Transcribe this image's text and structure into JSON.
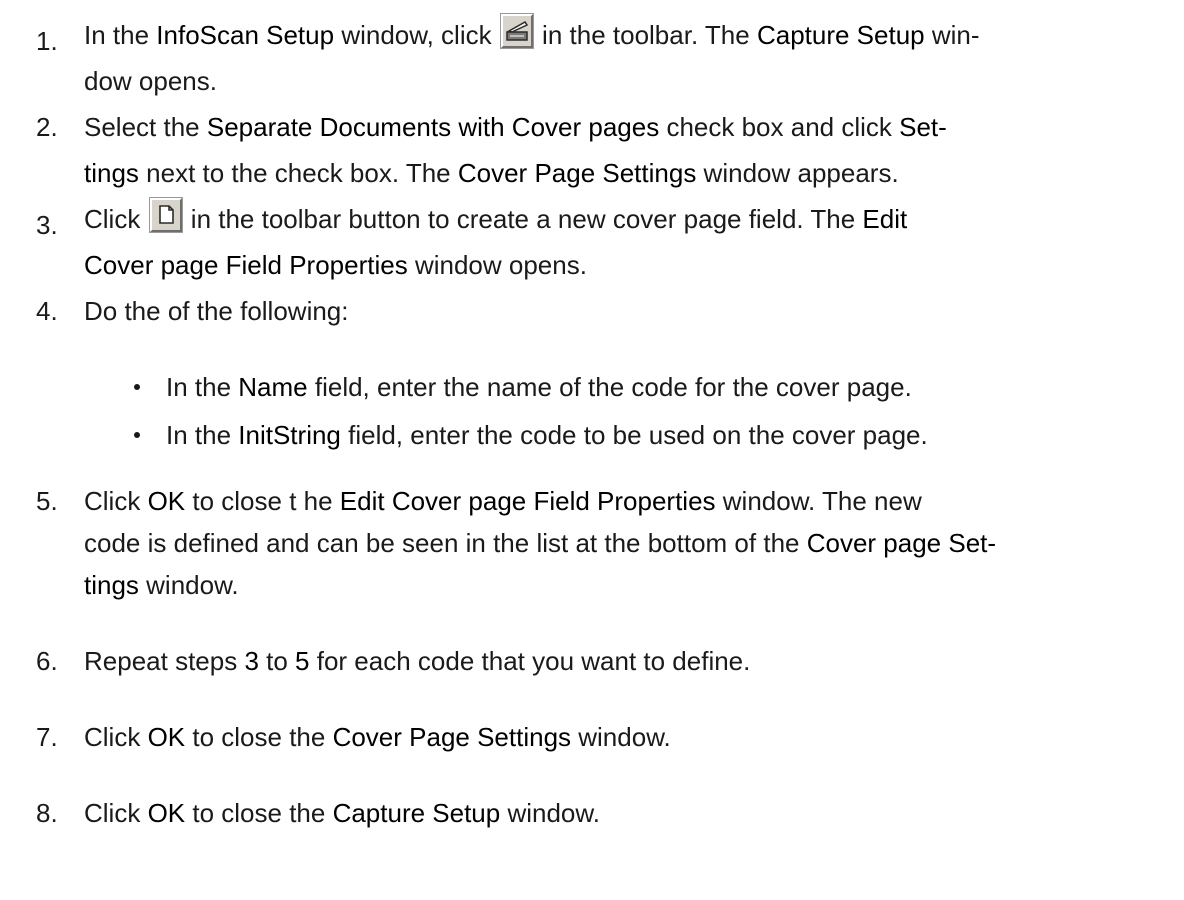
{
  "steps": [
    {
      "num": "1.",
      "parts": [
        {
          "t": "In the "
        },
        {
          "b": "InfoScan Setup"
        },
        {
          "t": " window, click "
        },
        {
          "icon": "scanner-icon"
        },
        {
          "t": " in the toolbar. The "
        },
        {
          "b": "Capture Setup"
        },
        {
          "t": " win-"
        }
      ],
      "line2": "dow opens."
    },
    {
      "num": "2.",
      "line1": {
        "a": "Select the ",
        "b1": "Separate Documents with Cover pages",
        "c": " check box and click ",
        "b2": "Set-"
      },
      "line2": {
        "b1": "tings",
        "a": " next to the check box. The ",
        "b2": "Cover Page Settings",
        "c": " window appears."
      }
    },
    {
      "num": "3.",
      "line1": {
        "a": "Click ",
        "icon": "new-page-icon",
        "b": " in the toolbar button to create a new cover page field. The ",
        "b1": "Edit"
      },
      "line2": {
        "b1": "Cover page Field Properties",
        "a": " window opens."
      }
    },
    {
      "num": "4.",
      "text": "Do the of the following:"
    },
    {
      "num": "5.",
      "line1": {
        "a": "Click ",
        "b1": "OK",
        "c": " to close t he ",
        "b2": "Edit Cover page Field Properties",
        "d": " window. The new"
      },
      "line2": {
        "a": "code is defined and can be seen in the list at the bottom of the ",
        "b1": "Cover page Set-"
      },
      "line3": {
        "b1": "tings",
        "a": " window."
      }
    },
    {
      "num": "6.",
      "line1": {
        "a": "Repeat steps ",
        "b1": "3",
        "c": " to ",
        "b2": "5",
        "d": " for each code that you want to define."
      }
    },
    {
      "num": "7.",
      "line1": {
        "a": "Click ",
        "b1": "OK",
        "c": " to close the ",
        "b2": "Cover Page Settings",
        "d": " window."
      }
    },
    {
      "num": "8.",
      "line1": {
        "a": "Click ",
        "b1": "OK",
        "c": " to close the ",
        "b2": "Capture Setup",
        "d": " window."
      }
    }
  ],
  "bullets": [
    {
      "a": "In the ",
      "b": "Name",
      "c": " field, enter the name of the code for the cover page."
    },
    {
      "a": "In the ",
      "b": "InitString",
      "c": " field, enter the code to be used on the cover page."
    }
  ]
}
